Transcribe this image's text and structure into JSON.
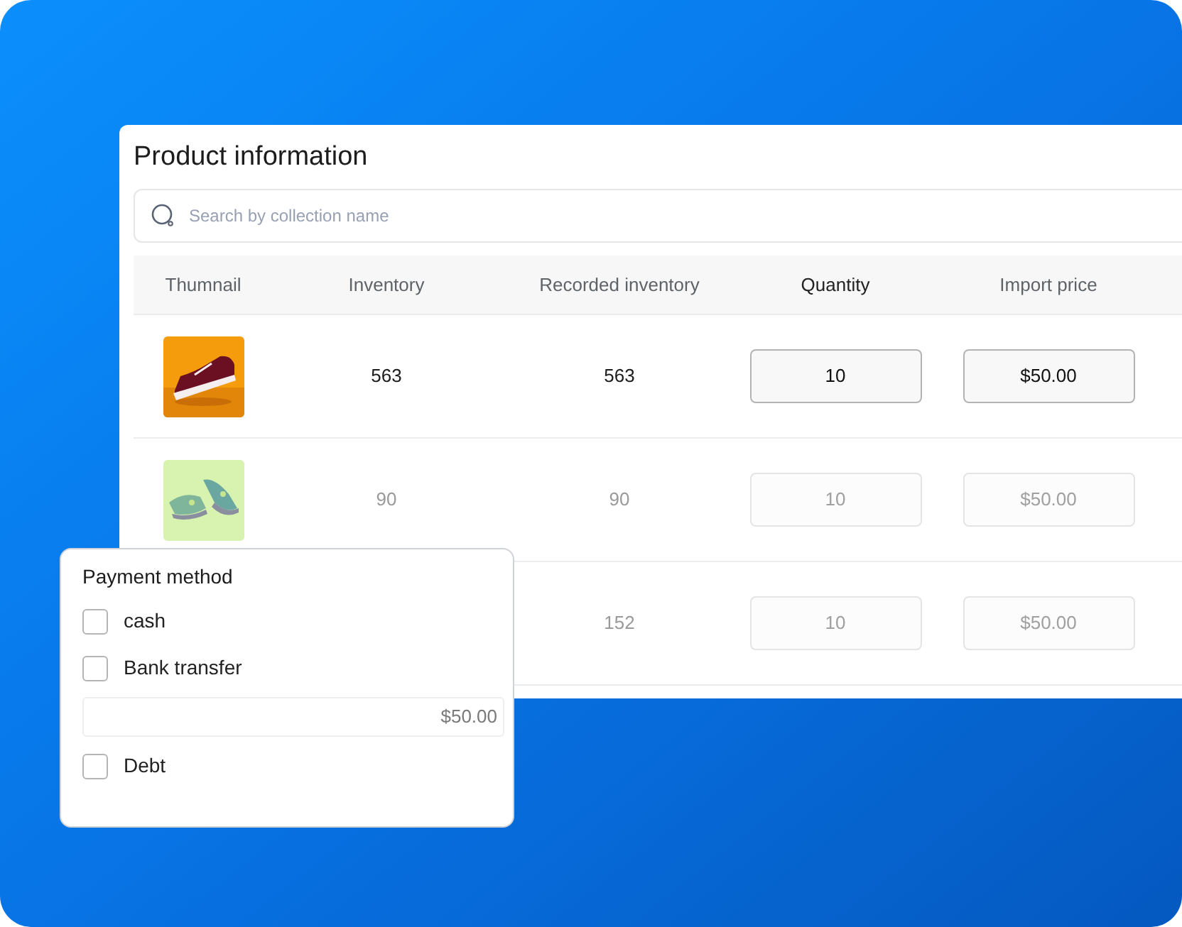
{
  "panel": {
    "title": "Product information"
  },
  "search": {
    "placeholder": "Search by collection name"
  },
  "table": {
    "columns": [
      {
        "label": "Thumnail",
        "emphasis": false
      },
      {
        "label": "Inventory",
        "emphasis": false
      },
      {
        "label": "Recorded inventory",
        "emphasis": false
      },
      {
        "label": "Quantity",
        "emphasis": true
      },
      {
        "label": "Import price",
        "emphasis": false
      }
    ],
    "rows": [
      {
        "disabled": false,
        "inventory": "563",
        "recorded_inventory": "563",
        "quantity": "10",
        "import_price": "$50.00"
      },
      {
        "disabled": true,
        "inventory": "90",
        "recorded_inventory": "90",
        "quantity": "10",
        "import_price": "$50.00"
      },
      {
        "disabled": true,
        "recorded_inventory": "152",
        "quantity": "10",
        "import_price": "$50.00"
      }
    ]
  },
  "payment": {
    "title": "Payment method",
    "items": [
      {
        "kind": "checkbox",
        "label": "cash",
        "checked": false
      },
      {
        "kind": "checkbox",
        "label": "Bank transfer",
        "checked": false
      },
      {
        "kind": "amount",
        "value": "$50.00"
      },
      {
        "kind": "checkbox",
        "label": "Debt",
        "checked": false
      }
    ]
  }
}
